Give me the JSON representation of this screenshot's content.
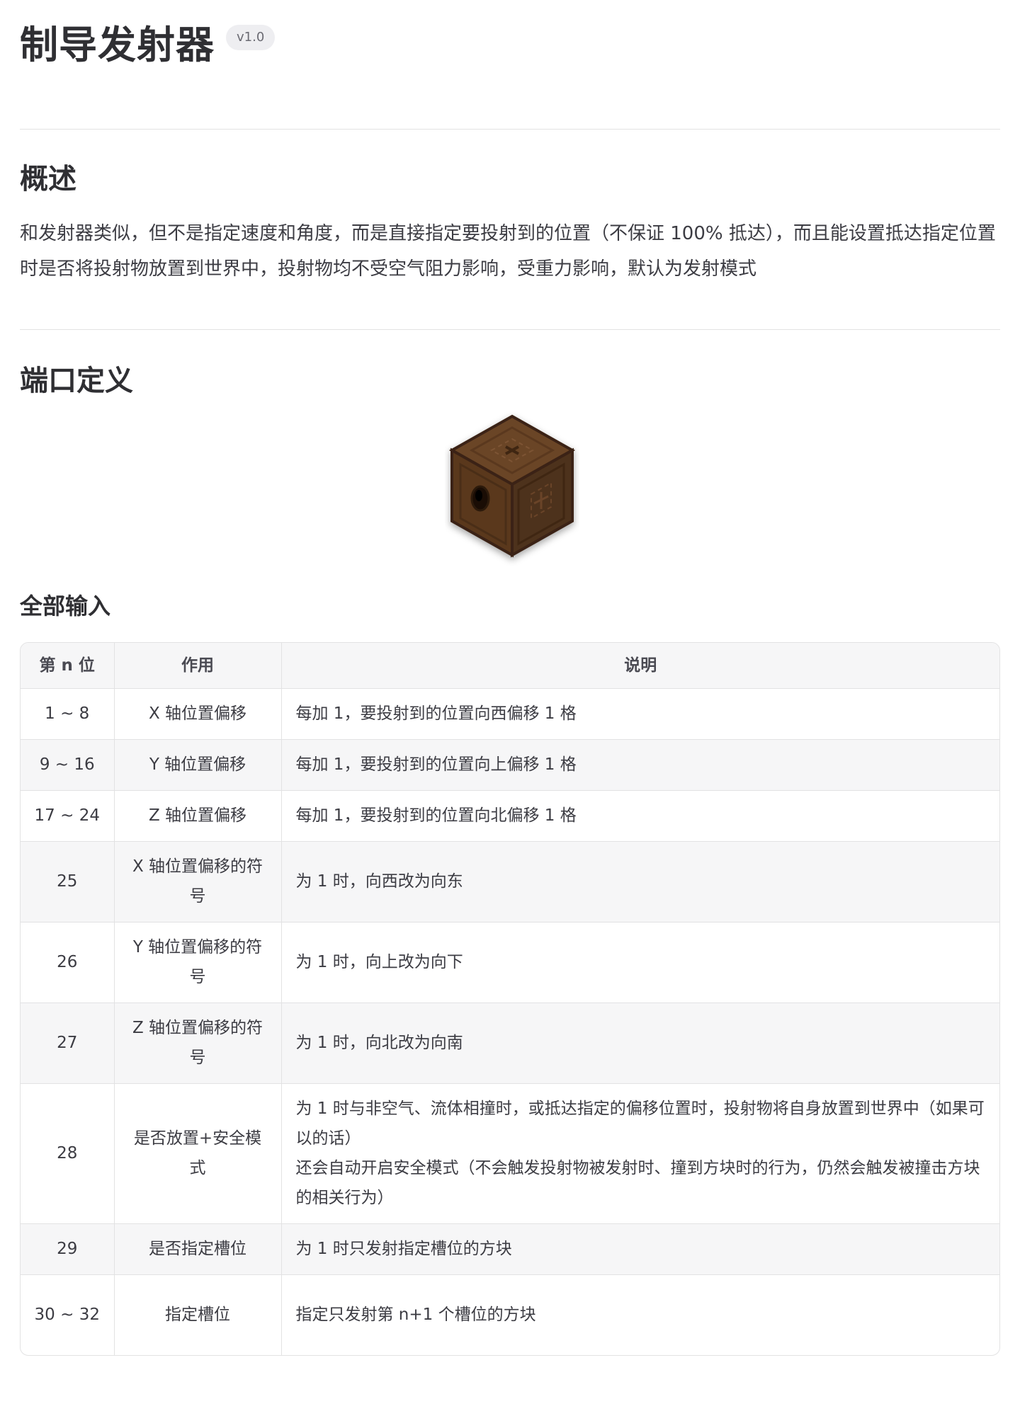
{
  "page": {
    "title": "制导发射器",
    "version": "v1.0"
  },
  "overview": {
    "heading": "概述",
    "text": "和发射器类似，但不是指定速度和角度，而是直接指定要投射到的位置（不保证 100% 抵达），而且能设置抵达指定位置时是否将投射物放置到世界中，投射物均不受空气阻力影响，受重力影响，默认为发射模式"
  },
  "ports": {
    "heading": "端口定义",
    "block_icon": "dispenser-block-icon",
    "inputs_heading": "全部输入",
    "table": {
      "headers": [
        "第 n 位",
        "作用",
        "说明"
      ],
      "rows": [
        {
          "n": "1 ~ 8",
          "fn": "X 轴位置偏移",
          "desc": "每加 1，要投射到的位置向西偏移 1 格"
        },
        {
          "n": "9 ~ 16",
          "fn": "Y 轴位置偏移",
          "desc": "每加 1，要投射到的位置向上偏移 1 格"
        },
        {
          "n": "17 ~ 24",
          "fn": "Z 轴位置偏移",
          "desc": "每加 1，要投射到的位置向北偏移 1 格"
        },
        {
          "n": "25",
          "fn": "X 轴位置偏移的符号",
          "desc": "为 1 时，向西改为向东"
        },
        {
          "n": "26",
          "fn": "Y 轴位置偏移的符号",
          "desc": "为 1 时，向上改为向下"
        },
        {
          "n": "27",
          "fn": "Z 轴位置偏移的符号",
          "desc": "为 1 时，向北改为向南"
        },
        {
          "n": "28",
          "fn": "是否放置+安全模式",
          "desc": "为 1 时与非空气、流体相撞时，或抵达指定的偏移位置时，投射物将自身放置到世界中（如果可以的话）",
          "desc2": "还会自动开启安全模式（不会触发投射物被发射时、撞到方块时的行为，仍然会触发被撞击方块的相关行为）"
        },
        {
          "n": "29",
          "fn": "是否指定槽位",
          "desc": "为 1 时只发射指定槽位的方块"
        },
        {
          "n": "30 ~ 32",
          "fn": "指定槽位",
          "desc": "指定只发射第 n+1 个槽位的方块"
        }
      ]
    }
  }
}
